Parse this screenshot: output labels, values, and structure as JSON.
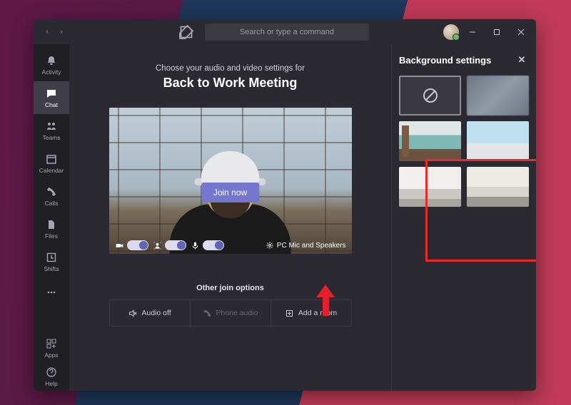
{
  "titlebar": {
    "search_placeholder": "Search or type a command"
  },
  "rail": {
    "items": [
      {
        "label": "Activity"
      },
      {
        "label": "Chat"
      },
      {
        "label": "Teams"
      },
      {
        "label": "Calendar"
      },
      {
        "label": "Calls"
      },
      {
        "label": "Files"
      },
      {
        "label": "Shifts"
      }
    ],
    "apps_label": "Apps",
    "help_label": "Help"
  },
  "prejoin": {
    "prompt": "Choose your audio and video settings for",
    "meeting_title": "Back to Work Meeting",
    "join_label": "Join now",
    "device_label": "PC Mic and Speakers",
    "camera_on": true,
    "bgfx_on": true,
    "mic_on": true
  },
  "other": {
    "heading": "Other join options",
    "audio_off": "Audio off",
    "phone_audio": "Phone audio",
    "add_room": "Add a room"
  },
  "panel": {
    "title": "Background settings"
  }
}
